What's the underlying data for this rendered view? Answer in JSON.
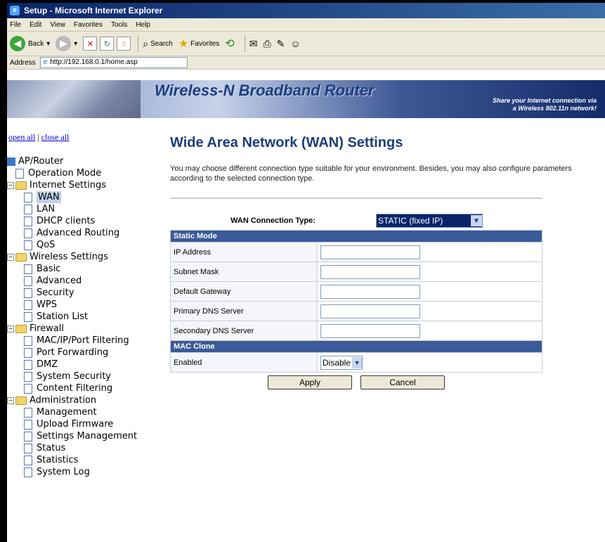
{
  "window": {
    "title": "Setup - Microsoft Internet Explorer"
  },
  "menu": [
    "File",
    "Edit",
    "View",
    "Favorites",
    "Tools",
    "Help"
  ],
  "toolbar": {
    "back": "Back",
    "search": "Search",
    "favorites": "Favorites"
  },
  "address": {
    "label": "Address",
    "url": "http://192.168.0.1/home.asp"
  },
  "banner": {
    "title": "Wireless-N Broadband Router",
    "tagline_line1": "Share your Internet connection via",
    "tagline_line2": "a Wireless 802.11n network!"
  },
  "nav": {
    "open_all": "open all",
    "separator": "|",
    "close_all": "close all",
    "root": "AP/Router",
    "items": [
      "Operation Mode",
      "Internet Settings",
      "WAN",
      "LAN",
      "DHCP clients",
      "Advanced Routing",
      "QoS",
      "Wireless Settings",
      "Basic",
      "Advanced",
      "Security",
      "WPS",
      "Station List",
      "Firewall",
      "MAC/IP/Port Filtering",
      "Port Forwarding",
      "DMZ",
      "System Security",
      "Content Filtering",
      "Administration",
      "Management",
      "Upload Firmware",
      "Settings Management",
      "Status",
      "Statistics",
      "System Log"
    ],
    "selected": "WAN"
  },
  "main": {
    "title": "Wide Area Network (WAN) Settings",
    "description": "You may choose different connection type suitable for your environment. Besides, you may also configure parameters according to the selected connection type.",
    "wan_type_label": "WAN Connection Type:",
    "wan_type_value": "STATIC (fixed IP)",
    "static_header": "Static Mode",
    "fields": [
      "IP Address",
      "Subnet Mask",
      "Default Gateway",
      "Primary DNS Server",
      "Secondary DNS Server"
    ],
    "mac_clone_header": "MAC Clone",
    "enabled_label": "Enabled",
    "enabled_value": "Disable",
    "apply": "Apply",
    "cancel": "Cancel"
  }
}
